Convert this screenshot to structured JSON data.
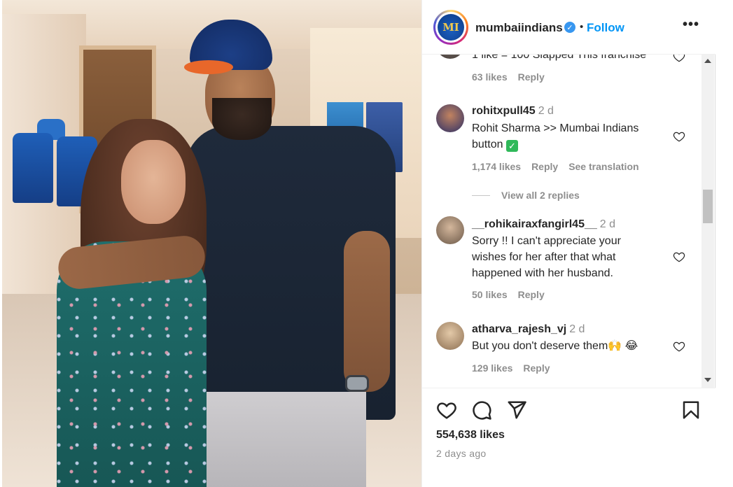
{
  "post": {
    "username": "mumbaiindians",
    "avatar_initials": "MI",
    "verified_icon": "verified-badge-icon",
    "separator": "•",
    "follow_label": "Follow",
    "more_label": "•••",
    "likes": "554,638 likes",
    "posted": "2 days ago"
  },
  "comments": [
    {
      "text": "1 like = 100 Slapped This franchise",
      "likes": "63 likes",
      "reply": "Reply"
    },
    {
      "username": "rohitxpull45",
      "time": "2 d",
      "text_line1": "Rohit Sharma >> Mumbai Indians",
      "text_line2": "button",
      "emoji": "✓",
      "likes": "1,174 likes",
      "reply": "Reply",
      "translate": "See translation",
      "view_replies": "View all 2 replies"
    },
    {
      "username": "__rohikairaxfangirl45__",
      "time": "2 d",
      "text_line1": "Sorry !! I can't appreciate your",
      "text_line2": "wishes for her after that what",
      "text_line3": "happened with her husband.",
      "likes": "50 likes",
      "reply": "Reply"
    },
    {
      "username": "atharva_rajesh_vj",
      "time": "2 d",
      "text": "But you don't deserve them🙌 😂",
      "likes": "129 likes",
      "reply": "Reply"
    }
  ],
  "colors": {
    "link": "#0095f6",
    "muted": "#8e8e8e",
    "text": "#262626",
    "verified": "#3897f0"
  },
  "icons": [
    "heart-icon",
    "comment-icon",
    "share-icon",
    "bookmark-icon",
    "more-icon"
  ]
}
